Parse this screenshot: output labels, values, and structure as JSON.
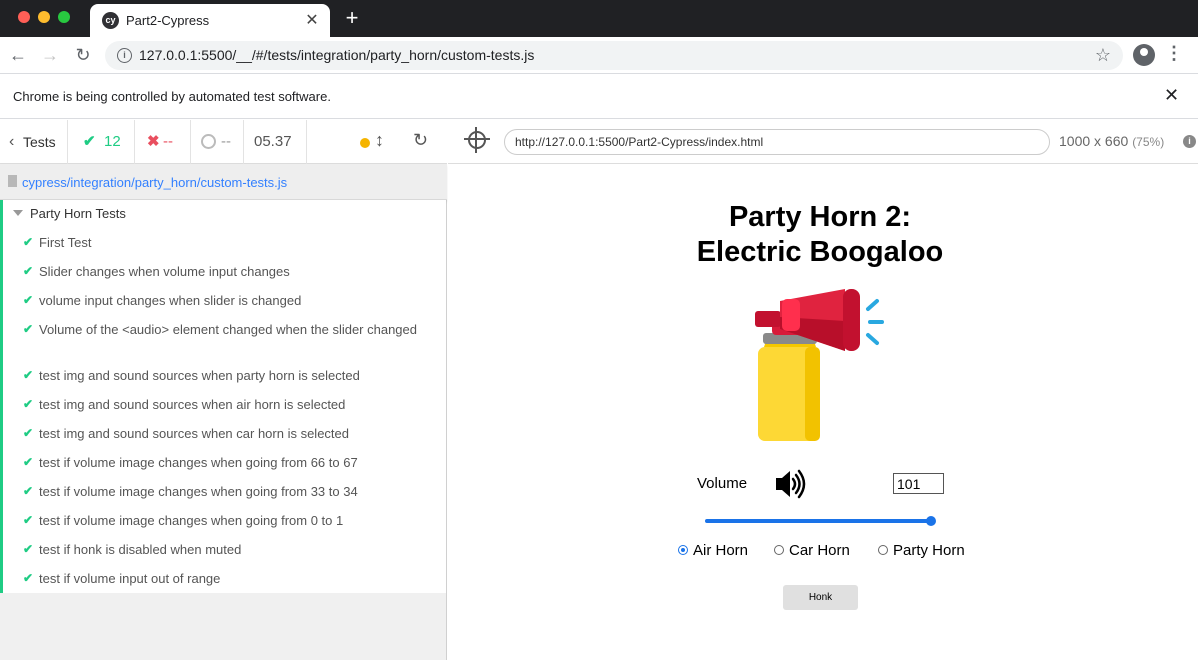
{
  "window": {
    "traffic_lights": {
      "close": "#ff5f57",
      "minimize": "#febc2e",
      "zoom": "#28c840"
    }
  },
  "browser": {
    "tab": {
      "favicon": "cy",
      "title": "Part2-Cypress",
      "close": "✕"
    },
    "new_tab": "+",
    "url": "127.0.0.1:5500/__/#/tests/integration/party_horn/custom-tests.js",
    "info_icon": "i",
    "infobar_text": "Chrome is being controlled by automated test software.",
    "infobar_close": "✕"
  },
  "reporter": {
    "tests_link": "Tests",
    "passed": "12",
    "failed": "--",
    "pending": "--",
    "duration": "05.37",
    "spec_path": "cypress/integration/party_horn/custom-tests.js",
    "suite_title": "Party Horn Tests",
    "tests": [
      "First Test",
      "Slider changes when volume input changes",
      "volume input changes when slider is changed",
      "Volume of the <audio> element changed when the slider changed",
      "test img and sound sources when party horn is selected",
      "test img and sound sources when air horn is selected",
      "test img and sound sources when car horn is selected",
      "test if volume image changes when going from 66 to 67",
      "test if volume image changes when going from 33 to 34",
      "test if volume image changes when going from 0 to 1",
      "test if honk is disabled when muted",
      "test if volume input out of range"
    ],
    "accent": "#1fcc84"
  },
  "aut": {
    "url": "http://127.0.0.1:5500/Part2-Cypress/index.html",
    "viewport": "1000 x 660",
    "scale": "(75%)",
    "info": "i"
  },
  "app": {
    "title_line1": "Party Horn 2:",
    "title_line2": "Electric Boogaloo",
    "volume_label": "Volume",
    "volume_value": "101",
    "slider_value": 100,
    "horns": [
      {
        "label": "Air Horn",
        "checked": true
      },
      {
        "label": "Car Horn",
        "checked": false
      },
      {
        "label": "Party Horn",
        "checked": false
      }
    ],
    "honk_label": "Honk",
    "icons": {
      "horn": "air-horn-icon",
      "volume": "volume-level-3-icon"
    }
  }
}
